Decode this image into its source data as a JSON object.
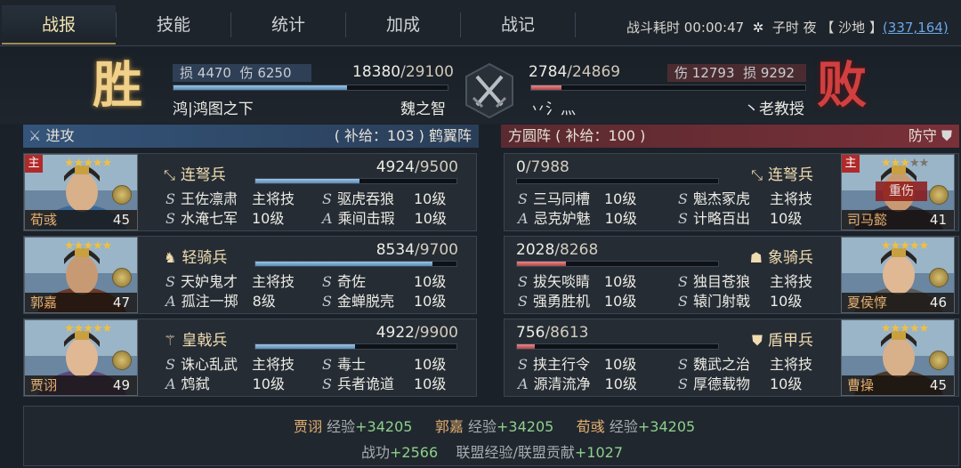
{
  "tabs": [
    {
      "label": "战报",
      "active": true
    },
    {
      "label": "技能"
    },
    {
      "label": "统计"
    },
    {
      "label": "加成"
    },
    {
      "label": "战记"
    }
  ],
  "status": {
    "duration_label": "战斗耗时",
    "duration": "00:00:47",
    "time_label": "子时 夜",
    "terrain": "【 沙地 】",
    "coords": "(337,164)"
  },
  "attacker": {
    "result": "胜",
    "loss_label": "损",
    "loss": "4470",
    "wound_label": "伤",
    "wound": "6250",
    "troops": "18380",
    "troops_max": "/29100",
    "troops_ratio": 0.632,
    "alliance": "鸿|鸿图之下",
    "player": "魏之智",
    "role": "进攻",
    "supply": "( 补给：103 )",
    "formation": "鹤翼阵"
  },
  "defender": {
    "result": "败",
    "loss_label": "损",
    "loss": "9292",
    "wound_label": "伤",
    "wound": "12793",
    "troops": "2784",
    "troops_max": "/24869",
    "troops_ratio": 0.112,
    "alliance": "丷氵灬",
    "player": "丶老教授",
    "role": "防守",
    "formation": "方圆阵",
    "supply": "( 补给：100 )"
  },
  "left_generals": [
    {
      "name": "荀彧",
      "level": "45",
      "main_label": "主",
      "is_main": true,
      "stars": 5,
      "lit": 5,
      "troop_icon": "crossbow-icon",
      "troop_type": "连弩兵",
      "hp": "4924",
      "hp_max": "/9500",
      "hp_ratio": 0.518,
      "skills": [
        {
          "type": "S",
          "name": "王佐凛肃",
          "level": "主将技"
        },
        {
          "type": "S",
          "name": "驱虎吞狼",
          "level": "10级"
        },
        {
          "type": "S",
          "name": "水淹七军",
          "level": "10级"
        },
        {
          "type": "A",
          "name": "乘间击瑕",
          "level": "10级"
        }
      ]
    },
    {
      "name": "郭嘉",
      "level": "47",
      "stars": 5,
      "lit": 5,
      "troop_icon": "horse-icon",
      "troop_type": "轻骑兵",
      "hp": "8534",
      "hp_max": "/9700",
      "hp_ratio": 0.88,
      "skills": [
        {
          "type": "S",
          "name": "天妒鬼才",
          "level": "主将技"
        },
        {
          "type": "S",
          "name": "奇佐",
          "level": "10级"
        },
        {
          "type": "A",
          "name": "孤注一掷",
          "level": "8级"
        },
        {
          "type": "S",
          "name": "金蝉脱壳",
          "level": "10级"
        }
      ]
    },
    {
      "name": "贾诩",
      "level": "49",
      "stars": 5,
      "lit": 5,
      "troop_icon": "halberd-icon",
      "troop_type": "皇戟兵",
      "hp": "4922",
      "hp_max": "/9900",
      "hp_ratio": 0.497,
      "skills": [
        {
          "type": "S",
          "name": "诛心乱武",
          "level": "主将技"
        },
        {
          "type": "S",
          "name": "毒士",
          "level": "10级"
        },
        {
          "type": "A",
          "name": "鸩弑",
          "level": "10级"
        },
        {
          "type": "S",
          "name": "兵者诡道",
          "level": "10级"
        }
      ]
    }
  ],
  "right_generals": [
    {
      "name": "司马懿",
      "level": "41",
      "main_label": "主",
      "is_main": true,
      "stars": 5,
      "lit": 3,
      "injured": "重伤",
      "troop_icon": "crossbow-icon",
      "troop_type": "连弩兵",
      "hp": "0",
      "hp_max": "/7988",
      "hp_ratio": 0.0,
      "skills": [
        {
          "type": "S",
          "name": "三马同槽",
          "level": "10级"
        },
        {
          "type": "S",
          "name": "魁杰冢虎",
          "level": "主将技"
        },
        {
          "type": "A",
          "name": "忌克妒魅",
          "level": "10级"
        },
        {
          "type": "S",
          "name": "计略百出",
          "level": "10级"
        }
      ]
    },
    {
      "name": "夏侯惇",
      "level": "46",
      "stars": 5,
      "lit": 5,
      "troop_icon": "elephant-icon",
      "troop_type": "象骑兵",
      "hp": "2028",
      "hp_max": "/8268",
      "hp_ratio": 0.245,
      "skills": [
        {
          "type": "S",
          "name": "拔矢啖睛",
          "level": "10级"
        },
        {
          "type": "S",
          "name": "独目苍狼",
          "level": "主将技"
        },
        {
          "type": "S",
          "name": "强勇胜机",
          "level": "10级"
        },
        {
          "type": "S",
          "name": "辕门射戟",
          "level": "10级"
        }
      ]
    },
    {
      "name": "曹操",
      "level": "45",
      "stars": 5,
      "lit": 5,
      "troop_icon": "shield-icon",
      "troop_type": "盾甲兵",
      "hp": "756",
      "hp_max": "/8613",
      "hp_ratio": 0.088,
      "skills": [
        {
          "type": "S",
          "name": "挟主行令",
          "level": "10级"
        },
        {
          "type": "S",
          "name": "魏武之治",
          "level": "主将技"
        },
        {
          "type": "A",
          "name": "源清流净",
          "level": "10级"
        },
        {
          "type": "S",
          "name": "厚德载物",
          "level": "10级"
        }
      ]
    }
  ],
  "rewards": {
    "exp_label": "经验",
    "exp": [
      {
        "name": "贾诩",
        "value": "+34205"
      },
      {
        "name": "郭嘉",
        "value": "+34205"
      },
      {
        "name": "荀彧",
        "value": "+34205"
      }
    ],
    "merit_label": "战功",
    "merit": "+2566",
    "alliance_label": "联盟经验/联盟贡献",
    "alliance": "+1027"
  },
  "colors": {
    "win": "#f0d08a",
    "lose": "#d04040",
    "attacker_bar": "#34547a",
    "defender_bar": "#7a3038",
    "exp_gain": "#8ed08a"
  }
}
